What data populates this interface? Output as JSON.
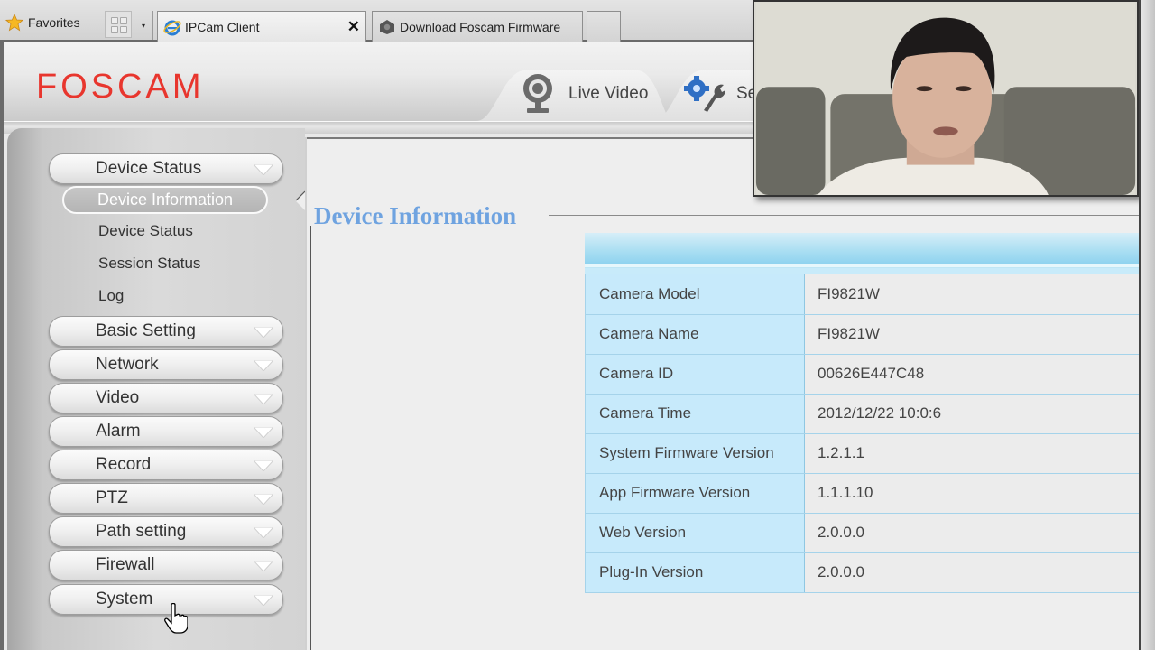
{
  "browser": {
    "favorites_label": "Favorites",
    "tabs": [
      {
        "title": "IPCam Client",
        "active": true,
        "close_glyph": "✕"
      },
      {
        "title": "Download Foscam Firmware",
        "active": false
      }
    ],
    "tab_list_glyph": "▾"
  },
  "app": {
    "brand": "FOSCAM",
    "brand_color": "#e8362e",
    "nav_tabs": [
      {
        "label": "Live Video",
        "icon": "webcam-icon"
      },
      {
        "label": "Se",
        "icon": "settings-gear-wrench-icon"
      }
    ]
  },
  "sidebar": {
    "sections": [
      {
        "label": "Device Status",
        "expanded": true,
        "items": [
          {
            "label": "Device Information",
            "active": true
          },
          {
            "label": "Device Status",
            "active": false
          },
          {
            "label": "Session Status",
            "active": false
          },
          {
            "label": "Log",
            "active": false
          }
        ]
      },
      {
        "label": "Basic Setting"
      },
      {
        "label": "Network"
      },
      {
        "label": "Video"
      },
      {
        "label": "Alarm"
      },
      {
        "label": "Record"
      },
      {
        "label": "PTZ"
      },
      {
        "label": "Path setting"
      },
      {
        "label": "Firewall"
      },
      {
        "label": "System"
      }
    ]
  },
  "main": {
    "title": "Device Information",
    "title_color": "#6fa3e0",
    "rows": [
      {
        "label": "Camera Model",
        "value": "FI9821W"
      },
      {
        "label": "Camera Name",
        "value": "FI9821W"
      },
      {
        "label": "Camera ID",
        "value": "00626E447C48"
      },
      {
        "label": "Camera Time",
        "value": "2012/12/22 10:0:6"
      },
      {
        "label": "System Firmware Version",
        "value": "1.2.1.1"
      },
      {
        "label": "App Firmware Version",
        "value": "1.1.1.10"
      },
      {
        "label": "Web Version",
        "value": "2.0.0.0"
      },
      {
        "label": "Plug-In Version",
        "value": "2.0.0.0"
      }
    ]
  },
  "overlay": {
    "type": "webcam-video",
    "description": "Presenter webcam feed"
  }
}
